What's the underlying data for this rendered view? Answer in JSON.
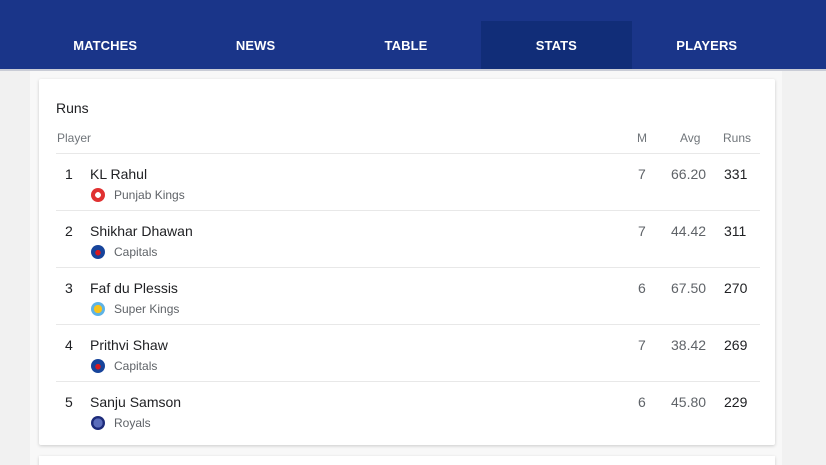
{
  "nav": {
    "tabs": [
      {
        "label": "MATCHES"
      },
      {
        "label": "NEWS"
      },
      {
        "label": "TABLE"
      },
      {
        "label": "STATS"
      },
      {
        "label": "PLAYERS"
      }
    ],
    "active_tab": "STATS"
  },
  "stats": {
    "title": "Runs",
    "headers": {
      "player": "Player",
      "matches": "M",
      "average": "Avg",
      "runs": "Runs"
    },
    "rows": [
      {
        "rank": "1",
        "name": "KL Rahul",
        "team": "Punjab Kings",
        "team_icon": "punjab-kings-logo-icon",
        "m": "7",
        "avg": "66.20",
        "runs": "331"
      },
      {
        "rank": "2",
        "name": "Shikhar Dhawan",
        "team": "Capitals",
        "team_icon": "capitals-logo-icon",
        "m": "7",
        "avg": "44.42",
        "runs": "311"
      },
      {
        "rank": "3",
        "name": "Faf du Plessis",
        "team": "Super Kings",
        "team_icon": "super-kings-logo-icon",
        "m": "6",
        "avg": "67.50",
        "runs": "270"
      },
      {
        "rank": "4",
        "name": "Prithvi Shaw",
        "team": "Capitals",
        "team_icon": "capitals-logo-icon",
        "m": "7",
        "avg": "38.42",
        "runs": "269"
      },
      {
        "rank": "5",
        "name": "Sanju Samson",
        "team": "Royals",
        "team_icon": "royals-logo-icon",
        "m": "6",
        "avg": "45.80",
        "runs": "229"
      }
    ]
  },
  "colors": {
    "header_bg": "#1a3589",
    "active_tab_bg": "#112d78",
    "page_bg": "#f1f1f1"
  }
}
